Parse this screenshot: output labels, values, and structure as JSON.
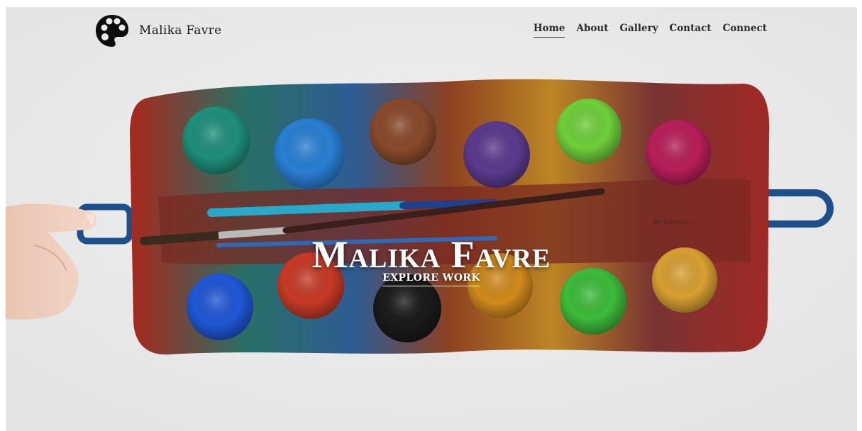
{
  "site": {
    "brand_name": "Malika Favre"
  },
  "header": {
    "logo_icon": "palette-icon",
    "nav": [
      {
        "label": "Home",
        "active": true
      },
      {
        "label": "About",
        "active": false
      },
      {
        "label": "Gallery",
        "active": false
      },
      {
        "label": "Contact",
        "active": false
      },
      {
        "label": "Connect",
        "active": false
      }
    ]
  },
  "hero": {
    "title": "Malika Favre",
    "cta_label": "EXPLORE WORK",
    "image": "watercolor-paint-palette-photo",
    "palette_text": "99 Schwarz",
    "colors": {
      "tray_red": "#c8352a",
      "handle_blue": "#1d4f8c",
      "paint_top": [
        "#1f8f7a",
        "#2a7fd4",
        "#8a4a2c",
        "#5b3a8f",
        "#6fcf3a",
        "#b81f5a"
      ],
      "paint_bottom": [
        "#1f57d6",
        "#c73a26",
        "#1a1a1a",
        "#d18a1c",
        "#3dbb3a",
        "#d9a032"
      ]
    }
  }
}
